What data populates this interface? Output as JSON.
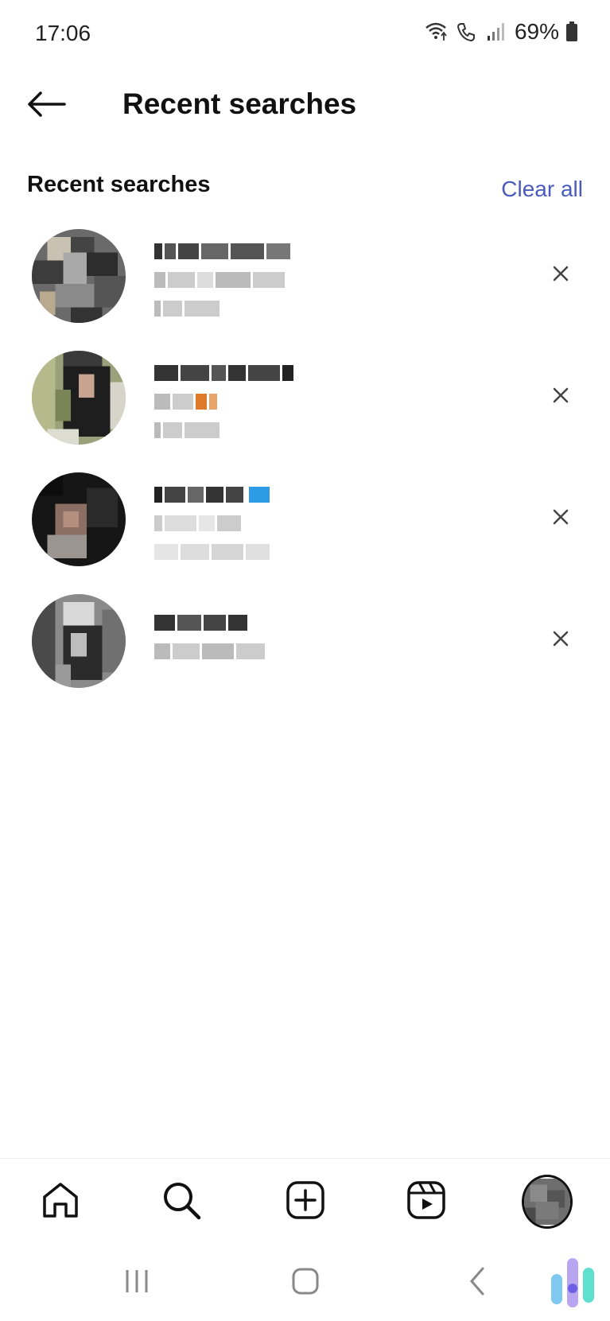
{
  "status_bar": {
    "time": "17:06",
    "battery_percent": "69%",
    "icons": [
      "wifi-calling-icon",
      "call-icon",
      "signal-icon",
      "battery-icon"
    ]
  },
  "header": {
    "title": "Recent searches",
    "back_icon": "back-arrow-icon"
  },
  "section": {
    "title": "Recent searches",
    "clear_all": "Clear all",
    "accent_color": "#4a5bbd"
  },
  "results": [
    {
      "name": "",
      "lines": 3,
      "remove_icon": "close-icon"
    },
    {
      "name": "",
      "lines": 3,
      "remove_icon": "close-icon"
    },
    {
      "name": "",
      "lines": 3,
      "remove_icon": "close-icon",
      "verified": true
    },
    {
      "name": "",
      "lines": 2,
      "remove_icon": "close-icon"
    }
  ],
  "bottom_nav": {
    "items": [
      "home-icon",
      "search-icon",
      "create-icon",
      "reels-icon",
      "profile-avatar"
    ]
  },
  "system_nav": {
    "items": [
      "recents-icon",
      "home-icon",
      "back-icon"
    ]
  }
}
